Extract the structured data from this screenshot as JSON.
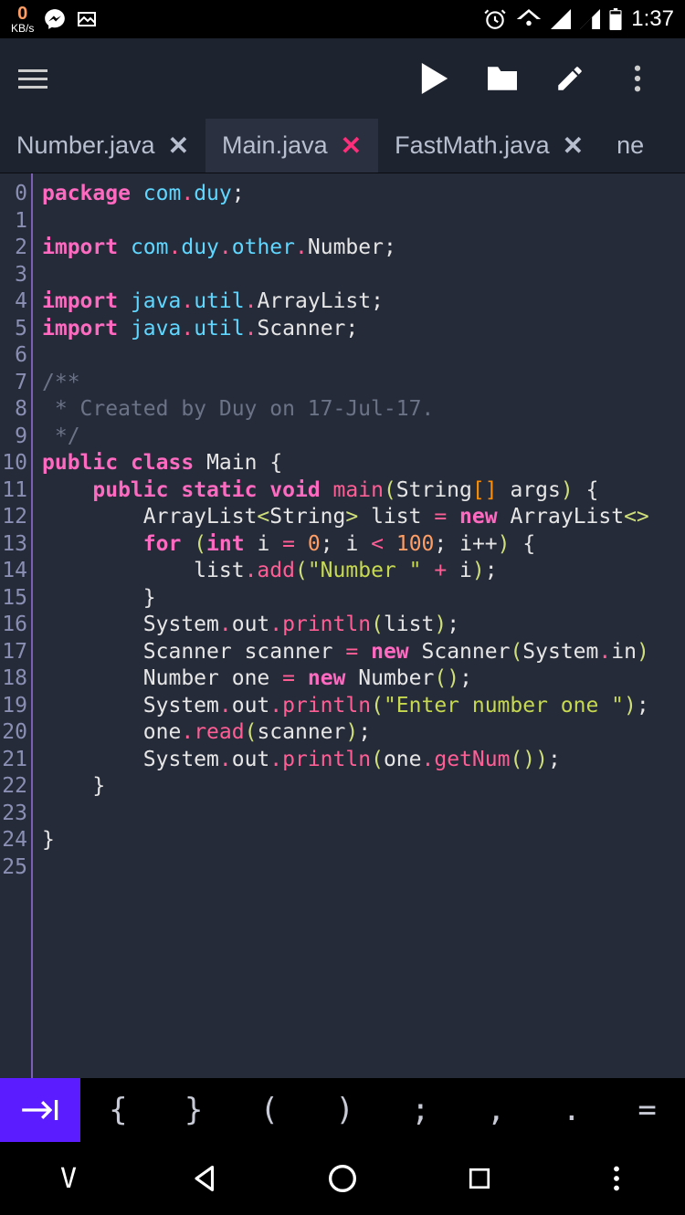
{
  "status": {
    "speed_num": "0",
    "speed_unit": "KB/s",
    "time": "1:37"
  },
  "tabs": [
    {
      "label": "Number.java",
      "active": false
    },
    {
      "label": "Main.java",
      "active": true
    },
    {
      "label": "FastMath.java",
      "active": false
    },
    {
      "label": "ne",
      "active": false
    }
  ],
  "gutter_lines": [
    "0",
    "1",
    "2",
    "3",
    "4",
    "5",
    "6",
    "7",
    "8",
    "9",
    "10",
    "11",
    "12",
    "13",
    "14",
    "15",
    "16",
    "17",
    "18",
    "19",
    "20",
    "21",
    "22",
    "23",
    "24",
    "25"
  ],
  "code": {
    "l0": {
      "kw": "package",
      "p1": "com",
      "p2": "duy"
    },
    "l2": {
      "kw": "import",
      "p1": "com",
      "p2": "duy",
      "p3": "other",
      "p4": "Number"
    },
    "l4": {
      "kw": "import",
      "p1": "java",
      "p2": "util",
      "p3": "ArrayList"
    },
    "l5": {
      "kw": "import",
      "p1": "java",
      "p2": "util",
      "p3": "Scanner"
    },
    "l7": "/**",
    "l8": " * Created by Duy on 17-Jul-17.",
    "l9": " */",
    "l10": {
      "kw1": "public",
      "kw2": "class",
      "name": "Main"
    },
    "l11": {
      "kw1": "public",
      "kw2": "static",
      "kw3": "void",
      "fn": "main",
      "type": "String",
      "arg": "args"
    },
    "l12": {
      "type1": "ArrayList",
      "gen": "String",
      "var": "list",
      "kw": "new",
      "type2": "ArrayList"
    },
    "l13": {
      "kw": "for",
      "type": "int",
      "var": "i",
      "n0": "0",
      "n1": "100",
      "inc": "i++"
    },
    "l14": {
      "obj": "list",
      "m": "add",
      "str": "\"Number \"",
      "var": "i"
    },
    "l16": {
      "o1": "System",
      "o2": "out",
      "m": "println",
      "arg": "list"
    },
    "l17": {
      "type": "Scanner",
      "var": "scanner",
      "kw": "new",
      "o1": "System",
      "o2": "in"
    },
    "l18": {
      "type": "Number",
      "var": "one",
      "kw": "new"
    },
    "l19": {
      "o1": "System",
      "o2": "out",
      "m": "println",
      "str": "\"Enter number one \""
    },
    "l20": {
      "o": "one",
      "m": "read",
      "arg": "scanner"
    },
    "l21": {
      "o1": "System",
      "o2": "out",
      "m": "println",
      "a1": "one",
      "a2": "getNum"
    }
  },
  "symbols": [
    "{",
    "}",
    "(",
    ")",
    ";",
    ",",
    ".",
    "="
  ]
}
